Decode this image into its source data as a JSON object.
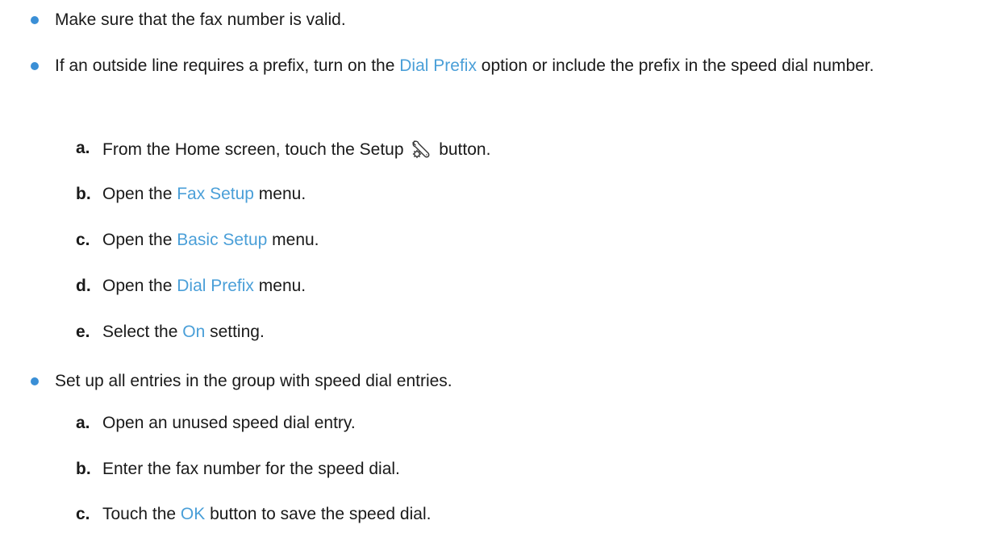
{
  "bullets": [
    {
      "text": "Make sure that the fax number is valid."
    },
    {
      "before": "If an outside line requires a prefix, turn on the ",
      "ui": "Dial Prefix",
      "after": " option or include the prefix in the speed dial number.",
      "steps": [
        {
          "letter": "a.",
          "before": "From the Home screen, touch the Setup ",
          "icon": "setup-wrench-gear-icon",
          "after": " button."
        },
        {
          "letter": "b.",
          "before": "Open the ",
          "ui": "Fax Setup",
          "after": " menu."
        },
        {
          "letter": "c.",
          "before": "Open the ",
          "ui": "Basic Setup",
          "after": " menu."
        },
        {
          "letter": "d.",
          "before": "Open the ",
          "ui": "Dial Prefix",
          "after": " menu."
        },
        {
          "letter": "e.",
          "before": "Select the ",
          "ui": "On",
          "after": " setting."
        }
      ]
    },
    {
      "text": "Set up all entries in the group with speed dial entries.",
      "steps": [
        {
          "letter": "a.",
          "text": "Open an unused speed dial entry."
        },
        {
          "letter": "b.",
          "text": "Enter the fax number for the speed dial."
        },
        {
          "letter": "c.",
          "before": "Touch the ",
          "ui": "OK",
          "after": " button to save the speed dial."
        }
      ]
    }
  ],
  "colors": {
    "bullet": "#3a8fd6",
    "ui_text": "#4a9fd8",
    "body_text": "#1a1a1a"
  }
}
